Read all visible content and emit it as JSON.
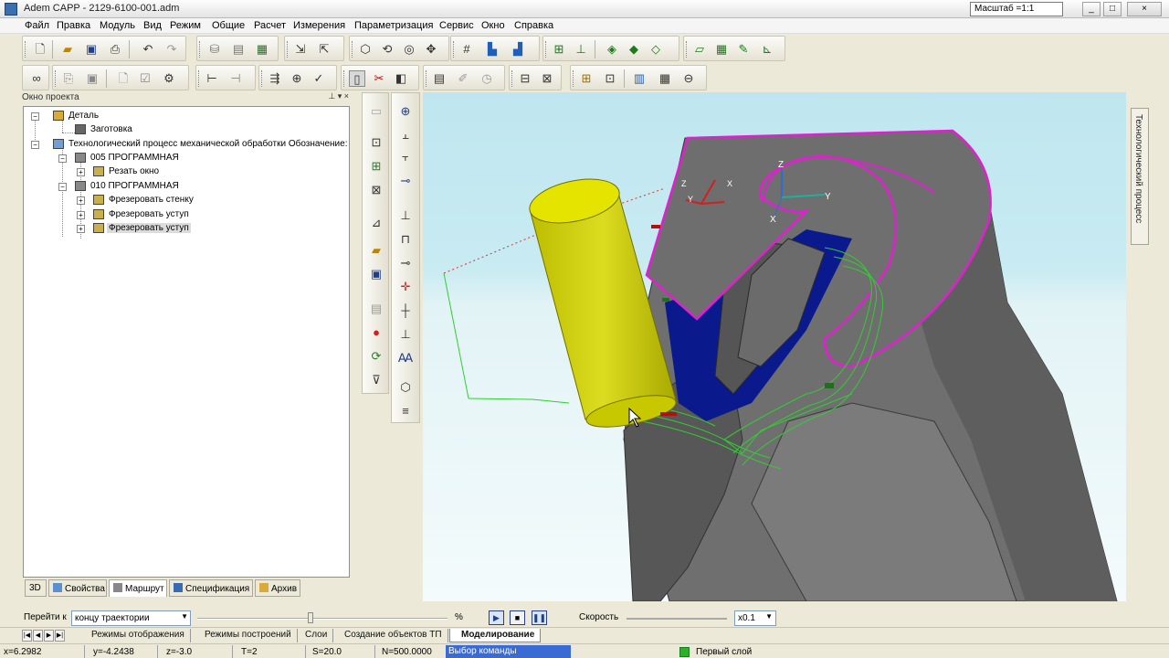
{
  "window": {
    "title": "Adem CAPP - 2129-6100-001.adm",
    "scale_label": "Масштаб =1:1",
    "controls": [
      "_",
      "□",
      "×"
    ]
  },
  "menu": [
    "Файл",
    "Правка",
    "Модуль",
    "Вид",
    "Режим",
    "Общие",
    "Расчет",
    "Измерения",
    "Параметризация",
    "Сервис",
    "Окно",
    "Справка"
  ],
  "project_panel": {
    "title": "Окно проекта",
    "header_buttons": "⊥ ▾ ×",
    "tree": [
      {
        "label": "Деталь"
      },
      {
        "label": "Заготовка"
      },
      {
        "label": "Технологический процесс механической обработки  Обозначение:"
      },
      {
        "label": "005  ПРОГРАММНАЯ"
      },
      {
        "label": "Резать окно"
      },
      {
        "label": "010  ПРОГРАММНАЯ"
      },
      {
        "label": "Фрезеровать стенку"
      },
      {
        "label": "Фрезеровать уступ"
      },
      {
        "label": "Фрезеровать уступ"
      }
    ],
    "tabs": [
      "3D",
      "Свойства",
      "Маршрут",
      "Спецификация",
      "Архив"
    ],
    "active_tab": "Маршрут"
  },
  "viewport": {
    "side_tab": "Технологический процесс",
    "colors": {
      "sky": "#c9e9ee",
      "part": "#6a6a6a",
      "tool": "#d6d600",
      "pocket": "#0a1a8c",
      "contour": "#e020d0",
      "toolpath": "#33cc33"
    },
    "axis_labels": {
      "z": "Z",
      "x": "X",
      "y": "Y"
    }
  },
  "playback": {
    "goto_label": "Перейти к",
    "goto_value": "концу траектории",
    "goto_progress": 0.45,
    "percent_sign": "%",
    "speed_label": "Скорость",
    "speed_value": "x0.1",
    "buttons": {
      "play": "▶",
      "stop": "■",
      "pause": "❚❚"
    }
  },
  "bottom_tabs": [
    "Режимы отображения",
    "Режимы построений",
    "Слои",
    "Создание объектов ТП",
    "Моделирование"
  ],
  "active_bottom_tab": "Моделирование",
  "status": {
    "x": "x=6.2982",
    "y": "y=-4.2438",
    "z": "z=-3.0",
    "t": "T=2",
    "s": "S=20.0",
    "n": "N=500.0000",
    "command": "Выбор команды",
    "layer": "Первый слой"
  }
}
